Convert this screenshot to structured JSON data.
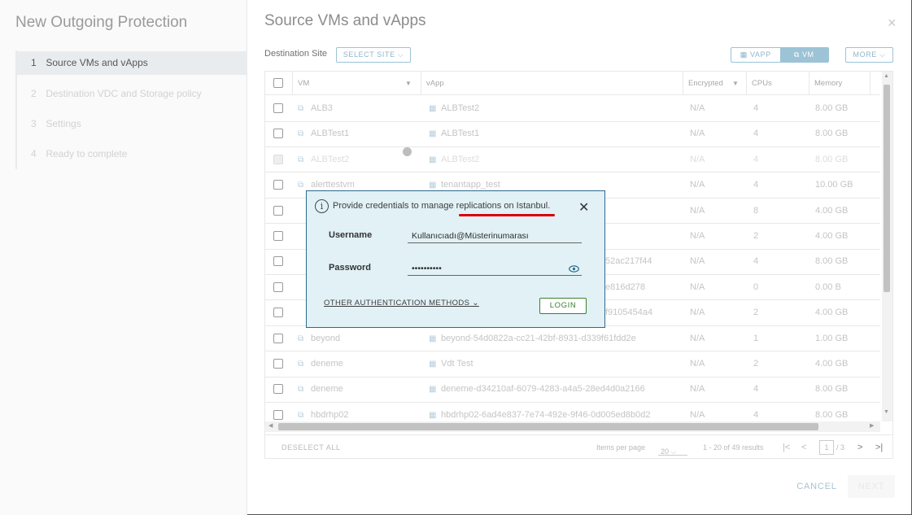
{
  "wizard": {
    "title": "New Outgoing Protection",
    "steps": [
      {
        "num": "1",
        "label": "Source VMs and vApps",
        "active": true
      },
      {
        "num": "2",
        "label": "Destination VDC and Storage policy",
        "active": false
      },
      {
        "num": "3",
        "label": "Settings",
        "active": false
      },
      {
        "num": "4",
        "label": "Ready to complete",
        "active": false
      }
    ]
  },
  "main": {
    "title": "Source VMs and vApps",
    "destination_label": "Destination Site",
    "select_site_label": "SELECT SITE ⌵",
    "toggle": {
      "vapp": "▦ VAPP",
      "vm": "⧉ VM"
    },
    "more_label": "MORE ⌵"
  },
  "grid": {
    "headers": [
      "VM",
      "vApp",
      "Encrypted",
      "CPUs",
      "Memory"
    ],
    "rows": [
      {
        "vm": "ALB3",
        "vapp": "ALBTest2",
        "encrypted": "N/A",
        "cpus": "4",
        "memory": "8.00 GB",
        "disabled": false
      },
      {
        "vm": "ALBTest1",
        "vapp": "ALBTest1",
        "encrypted": "N/A",
        "cpus": "4",
        "memory": "8.00 GB",
        "disabled": false
      },
      {
        "vm": "ALBTest2",
        "vapp": "ALBTest2",
        "encrypted": "N/A",
        "cpus": "4",
        "memory": "8.00 GB",
        "disabled": true
      },
      {
        "vm": "alerttestvm",
        "vapp": "tenantapp_test",
        "encrypted": "N/A",
        "cpus": "4",
        "memory": "10.00 GB",
        "disabled": false
      },
      {
        "vm": "",
        "vapp": "",
        "encrypted": "N/A",
        "cpus": "8",
        "memory": "4.00 GB",
        "disabled": false
      },
      {
        "vm": "",
        "vapp": "",
        "encrypted": "N/A",
        "cpus": "2",
        "memory": "4.00 GB",
        "disabled": false
      },
      {
        "vm": "",
        "vapp": "52ac217f44",
        "encrypted": "N/A",
        "cpus": "4",
        "memory": "8.00 GB",
        "disabled": false
      },
      {
        "vm": "",
        "vapp": "e816d278",
        "encrypted": "N/A",
        "cpus": "0",
        "memory": "0.00 B",
        "disabled": false
      },
      {
        "vm": "",
        "vapp": "f9105454a4",
        "encrypted": "N/A",
        "cpus": "2",
        "memory": "4.00 GB",
        "disabled": false
      },
      {
        "vm": "beyond",
        "vapp": "beyond-54d0822a-cc21-42bf-8931-d339f61fdd2e",
        "encrypted": "N/A",
        "cpus": "1",
        "memory": "1.00 GB",
        "disabled": false
      },
      {
        "vm": "deneme",
        "vapp": "Vdt Test",
        "encrypted": "N/A",
        "cpus": "2",
        "memory": "4.00 GB",
        "disabled": false
      },
      {
        "vm": "deneme",
        "vapp": "deneme-d34210af-6079-4283-a4a5-28ed4d0a2166",
        "encrypted": "N/A",
        "cpus": "4",
        "memory": "8.00 GB",
        "disabled": false
      },
      {
        "vm": "hbdrhp02",
        "vapp": "hbdrhp02-6ad4e837-7e74-492e-9f46-0d005ed8b0d2",
        "encrypted": "N/A",
        "cpus": "4",
        "memory": "8.00 GB",
        "disabled": false
      }
    ],
    "footer": {
      "deselect": "DESELECT ALL",
      "items_per_page_label": "Items per page",
      "items_per_page": "20",
      "results": "1 - 20 of 49 results",
      "page": "1",
      "page_total": "/ 3"
    }
  },
  "footer": {
    "cancel": "CANCEL",
    "next": "NEXT"
  },
  "modal": {
    "message_prefix": "Provide credentials to manage ",
    "message_link": "replications on ",
    "message_site": "Istanbul",
    "message_end": ".",
    "username_label": "Username",
    "username_value": "Kullanıcıadı@Müsterinumarası",
    "password_label": "Password",
    "password_value": "••••••••••",
    "other_auth": "OTHER AUTHENTICATION METHODS",
    "login": "LOGIN"
  }
}
